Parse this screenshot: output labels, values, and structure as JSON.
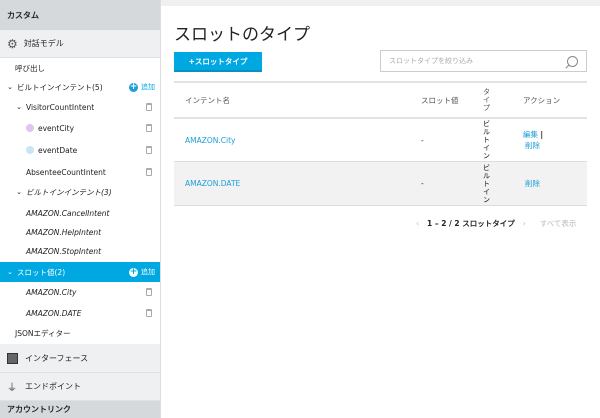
{
  "sidebar": {
    "custom": "カスタム",
    "dialog_model": "対話モデル",
    "invocation": "呼び出し",
    "builtin_intents": "ビルトインインテント(5)",
    "add": "追加",
    "visitor_intent": "VisitorCountIntent",
    "slots": [
      {
        "label": "eventCity",
        "color": "#e2c4f2"
      },
      {
        "label": "eventDate",
        "color": "#c6e6f7"
      }
    ],
    "absentee_intent": "AbsenteeCountIntent",
    "builtin_sub": "ビルトインインテント(3)",
    "builtin_items": [
      "AMAZON.CancelIntent",
      "AMAZON.HelpIntent",
      "AMAZON.StopIntent"
    ],
    "slot_values": "スロット値(2)",
    "slot_items": [
      "AMAZON.City",
      "AMAZON.DATE"
    ],
    "json_editor": "JSONエディター",
    "interface": "インターフェース",
    "endpoint": "エンドポイント",
    "account_link": "アカウントリンク"
  },
  "main": {
    "title": "スロットのタイプ",
    "add_button": "+スロットタイプ",
    "search_placeholder": "スロットタイプを絞り込み",
    "columns": [
      "インテント名",
      "スロット値",
      "タイプ",
      "アクション"
    ],
    "rows": [
      {
        "name": "AMAZON.City",
        "slot": "-",
        "type": "ビルトイン",
        "actions": [
          "編集",
          "削除"
        ]
      },
      {
        "name": "AMAZON.DATE",
        "slot": "-",
        "type": "ビルトイン",
        "actions": [
          "削除"
        ]
      }
    ],
    "pager": {
      "range": "1 – 2 / 2 スロットタイプ",
      "show_all": "すべて表示"
    }
  },
  "colors": {
    "accent": "#00a8e1"
  }
}
